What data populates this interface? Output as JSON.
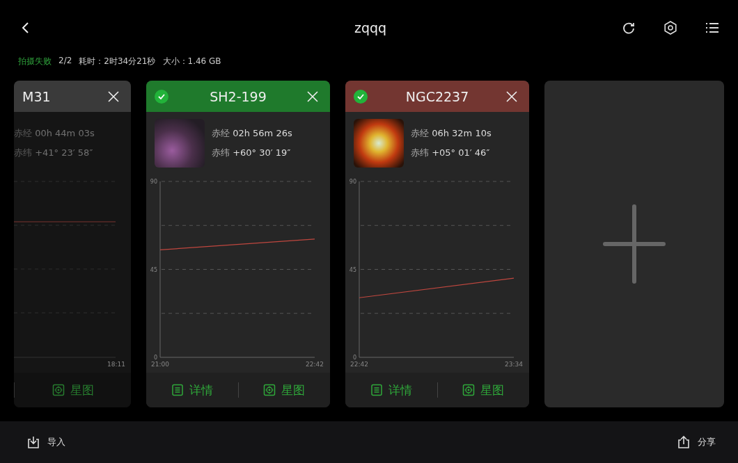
{
  "top_bar": {
    "title": "zqqq"
  },
  "summary": {
    "status": "拍摄失败",
    "count": "2/2",
    "duration": "耗时：2时34分21秒",
    "size": "大小：1.46 GB"
  },
  "cards": [
    {
      "name": "M31",
      "color": "#3a3a3a",
      "checked": false,
      "disabled": true,
      "thumbnail": false,
      "ra_label": "赤经",
      "ra": "00h 44m 03s",
      "dec_label": "赤纬",
      "dec": "+41° 23′ 58″",
      "end_time": "18:11",
      "actions": [
        {
          "kind": "chart",
          "label": "星图"
        }
      ]
    },
    {
      "name": "SH2-199",
      "color": "#1f7a2c",
      "checked": true,
      "disabled": false,
      "thumbnail": true,
      "ra_label": "赤经",
      "ra": "02h 56m 26s",
      "dec_label": "赤纬",
      "dec": "+60° 30′ 19″",
      "chart_data": {
        "type": "line",
        "x": [
          1260,
          1362
        ],
        "xlim": [
          1260,
          1362
        ],
        "ylim": [
          0,
          90
        ],
        "yticks": [
          0,
          45,
          90
        ],
        "xticks": [
          {
            "value": 1260,
            "label": "21:00"
          },
          {
            "value": 1362,
            "label": "22:42"
          }
        ],
        "series": [
          {
            "color": "#c0473f",
            "values": [
              55,
              60.5
            ]
          }
        ]
      },
      "actions": [
        {
          "kind": "details",
          "label": "详情"
        },
        {
          "kind": "chart",
          "label": "星图"
        }
      ]
    },
    {
      "name": "NGC2237",
      "color": "#733631",
      "checked": true,
      "disabled": false,
      "thumbnail": true,
      "ra_label": "赤经",
      "ra": "06h 32m 10s",
      "dec_label": "赤纬",
      "dec": "+05° 01′ 46″",
      "chart_data": {
        "type": "line",
        "x": [
          1362,
          1414
        ],
        "xlim": [
          1362,
          1414
        ],
        "ylim": [
          0,
          90
        ],
        "yticks": [
          0,
          45,
          90
        ],
        "xticks": [
          {
            "value": 1362,
            "label": "22:42"
          },
          {
            "value": 1414,
            "label": "23:34"
          }
        ],
        "series": [
          {
            "color": "#c0473f",
            "values": [
              30.5,
              40.5
            ]
          }
        ]
      },
      "actions": [
        {
          "kind": "details",
          "label": "详情"
        },
        {
          "kind": "chart",
          "label": "星图"
        }
      ]
    }
  ],
  "bottom_bar": {
    "import": "导入",
    "share": "分享"
  }
}
